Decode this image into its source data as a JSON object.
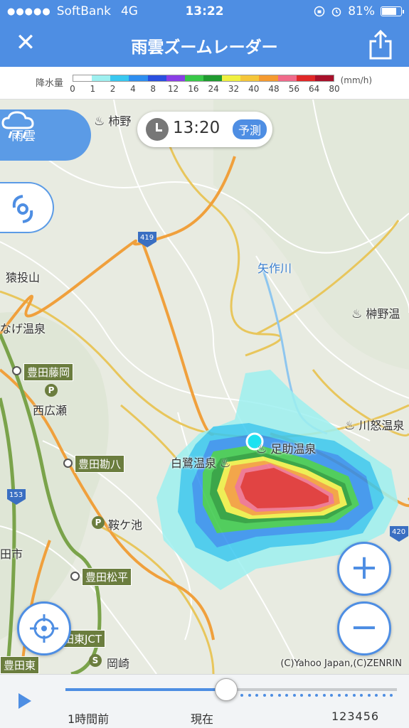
{
  "status_bar": {
    "signal_dots": "●●●●●",
    "carrier": "SoftBank",
    "network": "4G",
    "time": "13:22",
    "battery_percent": "81%",
    "battery_level": 0.81
  },
  "nav": {
    "title": "雨雲ズームレーダー",
    "close_icon": "close-icon",
    "share_icon": "share-icon"
  },
  "legend": {
    "title": "降水量",
    "unit": "(mm/h)",
    "ticks": [
      "0",
      "1",
      "2",
      "4",
      "8",
      "12",
      "16",
      "24",
      "32",
      "40",
      "48",
      "56",
      "64",
      "80"
    ],
    "colors": [
      "#ffffff",
      "#9ef0f0",
      "#39c8f0",
      "#2e8ef0",
      "#2a4fe0",
      "#8a3ee6",
      "#38c848",
      "#1f9a30",
      "#f0f040",
      "#f5c63a",
      "#f59a30",
      "#f06a8a",
      "#e02828",
      "#a8102a"
    ]
  },
  "time_pill": {
    "time": "13:20",
    "badge": "予測"
  },
  "layers": {
    "rain_label": "雨雲",
    "rain_icon": "rain-cloud-icon",
    "typhoon_icon": "typhoon-icon"
  },
  "map": {
    "labels": {
      "kakinoe": "柿野",
      "saruage": "猿投山",
      "yahagi": "矢作川",
      "sakakino": "榊野温",
      "nage": "なげ温泉",
      "kawaguri": "川怒温泉",
      "ashisuke": "足助温泉",
      "shirasagi": "白鷺温泉",
      "nishihirose": "西広瀬",
      "kuragaike": "鞍ケ池",
      "shi": "田市",
      "okazaki": "岡崎"
    },
    "signs": {
      "toyota_fujioka": "豊田藤岡",
      "toyota_kanpachi": "豊田勘八",
      "toyota_matsudaira": "豊田松平",
      "higashi_jct": "田東JCT",
      "toyota_higashi": "豊田東"
    },
    "routes": {
      "r419": "419",
      "r153": "153",
      "r420": "420"
    },
    "copyright": "(C)Yahoo Japan,(C)ZENRIN"
  },
  "controls": {
    "zoom_in": "+",
    "zoom_out": "−"
  },
  "timeline": {
    "left_label": "1時間前",
    "center_label": "現在",
    "right_label": "123456",
    "progress": 0.485
  }
}
